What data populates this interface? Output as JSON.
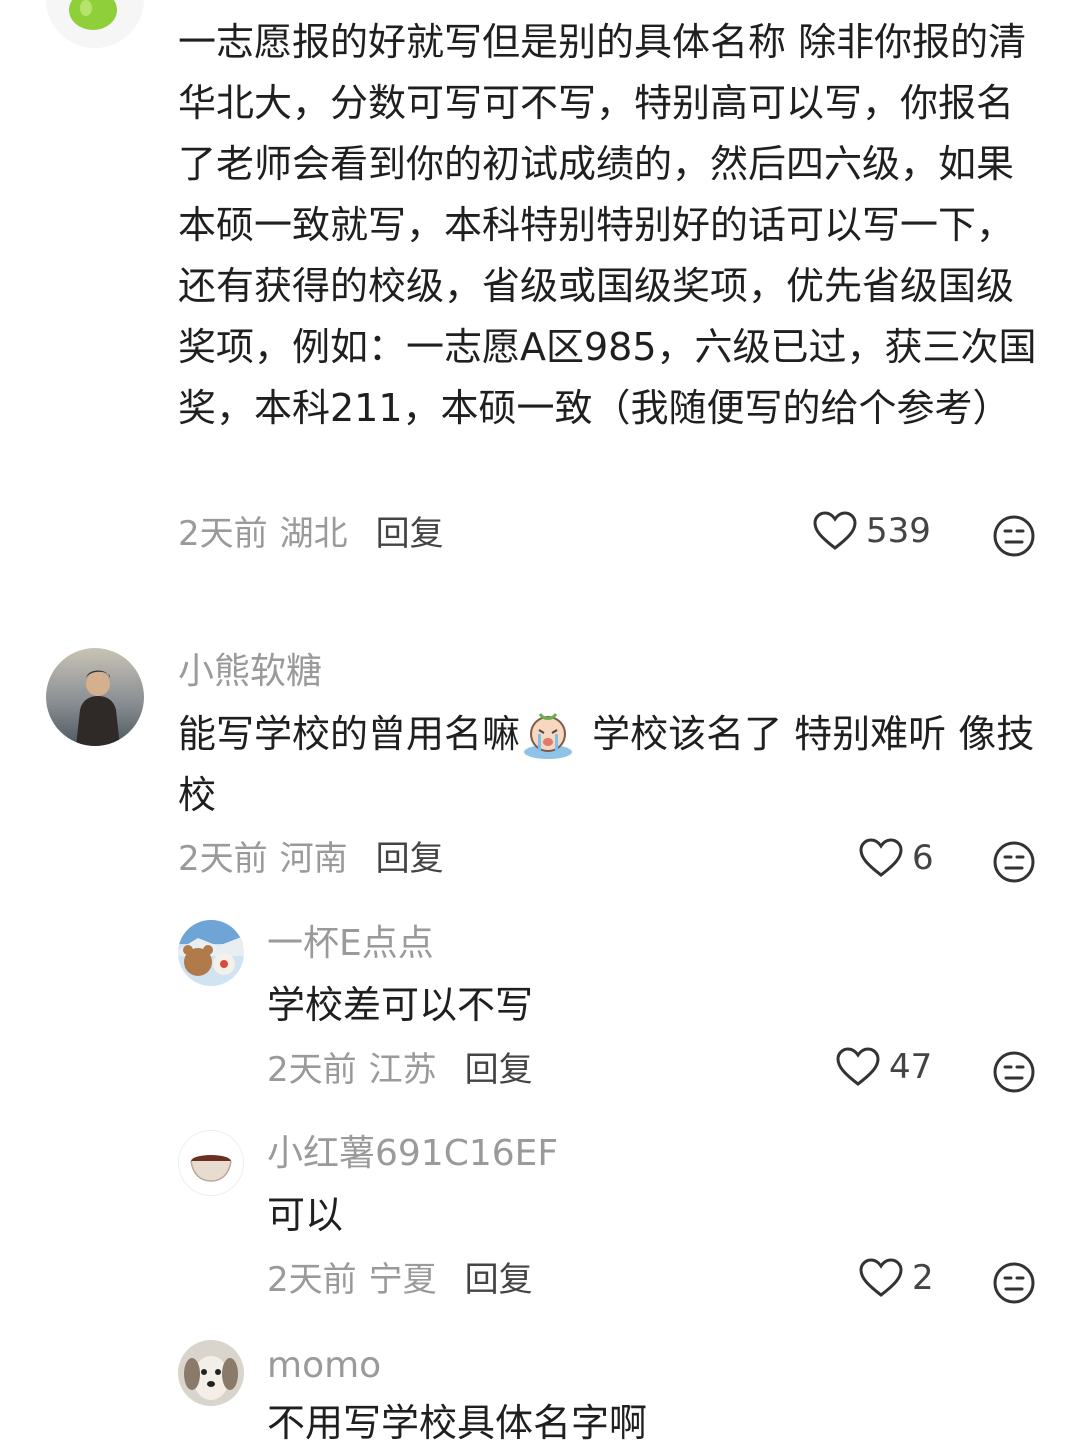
{
  "comments": [
    {
      "text": "一志愿报的好就写但是别的具体名称 除非你报的清华北大，分数可写可不写，特别高可以写，你报名了老师会看到你的初试成绩的，然后四六级，如果本硕一致就写，本科特别特别好的话可以写一下，还有获得的校级，省级或国级奖项，优先省级国级奖项，例如：一志愿A区985，六级已过，获三次国奖，本科211，本硕一致（我随便写的给个参考）",
      "time": "2天前",
      "location": "湖北",
      "reply": "回复",
      "likes": "539"
    },
    {
      "username": "小熊软糖",
      "text_before_emoji": "能写学校的曾用名嘛",
      "emoji": "crying-face-emoji",
      "text_after_emoji": " 学校该名了 特别难听 像技校",
      "time": "2天前",
      "location": "河南",
      "reply": "回复",
      "likes": "6"
    }
  ],
  "replies": [
    {
      "username": "一杯E点点",
      "text": "学校差可以不写",
      "time": "2天前",
      "location": "江苏",
      "reply": "回复",
      "likes": "47"
    },
    {
      "username": "小红薯691C16EF",
      "text": "可以",
      "time": "2天前",
      "location": "宁夏",
      "reply": "回复",
      "likes": "2"
    },
    {
      "username": "momo",
      "text": "不用写学校具体名字啊"
    }
  ],
  "icons": {
    "like": "heart-outline-icon",
    "dislike": "neutral-face-icon"
  },
  "colors": {
    "text": "#1f1f1f",
    "meta": "#9a9a9a",
    "reply": "#444444"
  }
}
